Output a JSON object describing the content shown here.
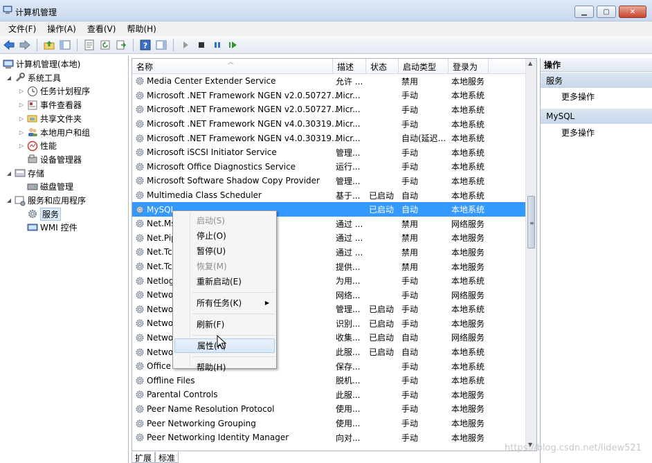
{
  "window": {
    "title": "计算机管理"
  },
  "menu": [
    "文件(F)",
    "操作(A)",
    "查看(V)",
    "帮助(H)"
  ],
  "tree": [
    {
      "label": "计算机管理(本地)",
      "level": 0,
      "twist": "",
      "icon": "computer-icon"
    },
    {
      "label": "系统工具",
      "level": 1,
      "twist": "◢",
      "icon": "tools-icon"
    },
    {
      "label": "任务计划程序",
      "level": 2,
      "twist": "▷",
      "icon": "clock-icon"
    },
    {
      "label": "事件查看器",
      "level": 2,
      "twist": "▷",
      "icon": "event-viewer-icon"
    },
    {
      "label": "共享文件夹",
      "level": 2,
      "twist": "▷",
      "icon": "shared-folder-icon"
    },
    {
      "label": "本地用户和组",
      "level": 2,
      "twist": "▷",
      "icon": "users-icon"
    },
    {
      "label": "性能",
      "level": 2,
      "twist": "▷",
      "icon": "performance-icon"
    },
    {
      "label": "设备管理器",
      "level": 2,
      "twist": "",
      "icon": "device-manager-icon"
    },
    {
      "label": "存储",
      "level": 1,
      "twist": "◢",
      "icon": "storage-icon"
    },
    {
      "label": "磁盘管理",
      "level": 2,
      "twist": "",
      "icon": "disk-icon"
    },
    {
      "label": "服务和应用程序",
      "level": 1,
      "twist": "◢",
      "icon": "services-apps-icon"
    },
    {
      "label": "服务",
      "level": 2,
      "twist": "",
      "icon": "services-icon",
      "selected": true
    },
    {
      "label": "WMI 控件",
      "level": 2,
      "twist": "",
      "icon": "wmi-icon"
    }
  ],
  "columns": {
    "name": "名称",
    "desc": "描述",
    "status": "状态",
    "startup": "启动类型",
    "logon": "登录为"
  },
  "services": [
    {
      "name": "Media Center Extender Service",
      "desc": "允许 ...",
      "status": "",
      "startup": "禁用",
      "logon": "本地服务"
    },
    {
      "name": "Microsoft .NET Framework NGEN v2.0.50727...",
      "desc": "Micr...",
      "status": "",
      "startup": "手动",
      "logon": "本地系统"
    },
    {
      "name": "Microsoft .NET Framework NGEN v2.0.50727...",
      "desc": "Micr...",
      "status": "",
      "startup": "手动",
      "logon": "本地系统"
    },
    {
      "name": "Microsoft .NET Framework NGEN v4.0.30319...",
      "desc": "Micr...",
      "status": "",
      "startup": "手动",
      "logon": "本地系统"
    },
    {
      "name": "Microsoft .NET Framework NGEN v4.0.30319...",
      "desc": "Micr...",
      "status": "",
      "startup": "自动(延迟...",
      "logon": "本地系统"
    },
    {
      "name": "Microsoft iSCSI Initiator Service",
      "desc": "管理...",
      "status": "",
      "startup": "手动",
      "logon": "本地系统"
    },
    {
      "name": "Microsoft Office Diagnostics Service",
      "desc": "运行...",
      "status": "",
      "startup": "手动",
      "logon": "本地系统"
    },
    {
      "name": "Microsoft Software Shadow Copy Provider",
      "desc": "管理...",
      "status": "",
      "startup": "手动",
      "logon": "本地系统"
    },
    {
      "name": "Multimedia Class Scheduler",
      "desc": "基于...",
      "status": "已启动",
      "startup": "自动",
      "logon": "本地系统"
    },
    {
      "name": "MySQL",
      "desc": "",
      "status": "已启动",
      "startup": "自动",
      "logon": "本地系统",
      "selected": true
    },
    {
      "name": "Net.Ms",
      "desc": "通过 ...",
      "status": "",
      "startup": "禁用",
      "logon": "网络服务"
    },
    {
      "name": "Net.Pip",
      "desc": "通过 ...",
      "status": "",
      "startup": "禁用",
      "logon": "本地服务"
    },
    {
      "name": "Net.Tc",
      "desc": "通过 ...",
      "status": "",
      "startup": "禁用",
      "logon": "本地服务"
    },
    {
      "name": "Net.Tc",
      "desc": "提供...",
      "status": "",
      "startup": "禁用",
      "logon": "本地服务"
    },
    {
      "name": "Netlog",
      "desc": "为用...",
      "status": "",
      "startup": "手动",
      "logon": "本地系统"
    },
    {
      "name": "Netwo",
      "desc": "网络...",
      "status": "",
      "startup": "手动",
      "logon": "网络服务"
    },
    {
      "name": "Netwo",
      "desc": "管理...",
      "status": "已启动",
      "startup": "手动",
      "logon": "本地系统"
    },
    {
      "name": "Netwo",
      "desc": "识别...",
      "status": "已启动",
      "startup": "手动",
      "logon": "本地服务"
    },
    {
      "name": "Netwo",
      "desc": "收集...",
      "status": "已启动",
      "startup": "自动",
      "logon": "网络服务"
    },
    {
      "name": "Netwo",
      "desc": "此服...",
      "status": "已启动",
      "startup": "自动",
      "logon": "本地系统"
    },
    {
      "name": "Office",
      "desc": "保存...",
      "status": "",
      "startup": "手动",
      "logon": "本地系统"
    },
    {
      "name": "Offline Files",
      "desc": "脱机...",
      "status": "",
      "startup": "手动",
      "logon": "本地系统"
    },
    {
      "name": "Parental Controls",
      "desc": "此服...",
      "status": "",
      "startup": "手动",
      "logon": "本地服务"
    },
    {
      "name": "Peer Name Resolution Protocol",
      "desc": "使用...",
      "status": "",
      "startup": "手动",
      "logon": "本地服务"
    },
    {
      "name": "Peer Networking Grouping",
      "desc": "使用...",
      "status": "",
      "startup": "手动",
      "logon": "本地服务"
    },
    {
      "name": "Peer Networking Identity Manager",
      "desc": "向对...",
      "status": "",
      "startup": "手动",
      "logon": "本地服务"
    }
  ],
  "context_menu": [
    {
      "label": "启动(S)",
      "disabled": true
    },
    {
      "label": "停止(O)"
    },
    {
      "label": "暂停(U)"
    },
    {
      "label": "恢复(M)",
      "disabled": true
    },
    {
      "label": "重新启动(E)"
    },
    {
      "sep": true
    },
    {
      "label": "所有任务(K)",
      "submenu": true
    },
    {
      "sep": true
    },
    {
      "label": "刷新(F)"
    },
    {
      "sep": true
    },
    {
      "label": "属性(R)",
      "hover": true
    },
    {
      "sep": true
    },
    {
      "label": "帮助(H)"
    }
  ],
  "actions": {
    "header": "操作",
    "sections": [
      {
        "title": "服务",
        "items": [
          "更多操作"
        ]
      },
      {
        "title": "MySQL",
        "items": [
          "更多操作"
        ]
      }
    ]
  },
  "bottom_tabs": [
    "扩展",
    "标准"
  ],
  "watermark": "https://blog.csdn.net/lidew521"
}
